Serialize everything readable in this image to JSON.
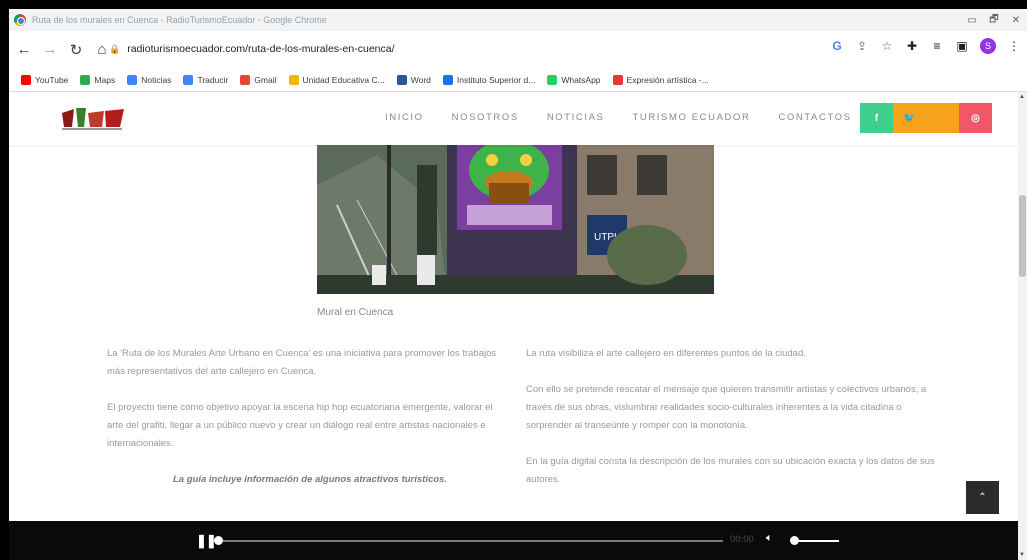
{
  "window": {
    "title": "Ruta de los murales en Cuenca - RadioTurismoEcuador - Google Chrome",
    "controls": [
      "▭",
      "🗗",
      "✕"
    ]
  },
  "browser": {
    "url": "radioturismoecuador.com/ruta-de-los-murales-en-cuenca/",
    "profile_initial": "S",
    "bookmarks": [
      {
        "label": "YouTube",
        "color": "#ff0000"
      },
      {
        "label": "Maps",
        "color": "#34a853"
      },
      {
        "label": "Noticias",
        "color": "#4285f4"
      },
      {
        "label": "Traducir",
        "color": "#4285f4"
      },
      {
        "label": "Gmail",
        "color": "#ea4335"
      },
      {
        "label": "Unidad Educativa C...",
        "color": "#f4b400"
      },
      {
        "label": "Word",
        "color": "#2b579a"
      },
      {
        "label": "Instituto Superior d...",
        "color": "#1a73e8"
      },
      {
        "label": "WhatsApp",
        "color": "#25d366"
      },
      {
        "label": "Expresión artística -...",
        "color": "#e53935"
      }
    ]
  },
  "site": {
    "nav": [
      "INICIO",
      "NOSOTROS",
      "NOTICIAS",
      "TURISMO ECUADOR",
      "CONTACTOS"
    ],
    "social": [
      {
        "icon": "facebook-icon",
        "glyph": "f",
        "color": "#3ecf8e"
      },
      {
        "icon": "twitter-icon",
        "glyph": "🐦",
        "color": "#f7a21b"
      },
      {
        "icon": "blank-icon",
        "glyph": "",
        "color": "#f7a21b"
      },
      {
        "icon": "instagram-icon",
        "glyph": "◎",
        "color": "#f05868"
      }
    ]
  },
  "article": {
    "image_caption": "Mural en Cuenca",
    "left_paragraphs": [
      "La 'Ruta de los Murales Arte Urbano en Cuenca' es una iniciativa para promover los trabajos más representativos del arte callejero en Cuenca.",
      "El proyecto tiene como objetivo apoyar la escena hip hop ecuatoriana emergente, valorar el arte del grafiti, llegar a un público nuevo y crear un diálogo real entre artistas nacionales e internacionales."
    ],
    "highlight": "La guía incluye información de algunos atractivos turísticos.",
    "right_paragraphs": [
      "La ruta visibiliza el arte callejero en diferentes puntos de la ciudad.",
      "Con ello se pretende rescatar el mensaje que quieren transmitir artistas y colectivos urbanos, a través de sus obras, vislumbrar realidades socio-culturales inherentes a la vida citadina o sorprender al transeúnte y romper con la monotonía.",
      "En la guía digital consta la descripción de los murales con su ubicación exacta y los datos de sus autores."
    ],
    "utpl_sign": "UTPL"
  },
  "player": {
    "time": "00:00",
    "progress": 0,
    "volume": 1
  },
  "colors": {
    "accent_green": "#3ecf8e",
    "accent_orange": "#f7a21b",
    "accent_pink": "#f05868"
  }
}
